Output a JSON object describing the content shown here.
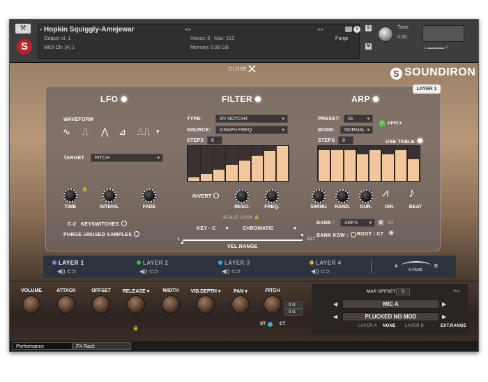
{
  "header": {
    "instrument": "Hopkin Squiggly-Amejewar",
    "output_label": "Output:",
    "output_val": "st. 1",
    "midi_label": "MIDI Ch:",
    "midi_val": "[A]  1",
    "voices_label": "Voices:",
    "voices_val": "0",
    "max_label": "Max:",
    "max_val": "512",
    "memory_label": "Memory:",
    "memory_val": "0.96 GB",
    "purge_label": "Purge",
    "solo": "S",
    "mute": "M",
    "tune_label": "Tune",
    "tune_val": "0.00",
    "aux_l": "L",
    "aux_r": "R"
  },
  "close_label": "CLOSE",
  "brand": "SOUNDIRON",
  "layer_chip": "LAYER 1",
  "lfo": {
    "title": "LFO",
    "waveform_label": "WAVEFORM",
    "waves": [
      "∿",
      "⎍",
      "⋀",
      "⊿",
      "⎍⎍"
    ],
    "target_label": "TARGET",
    "target_val": "PITCH",
    "knobs": [
      "TIME",
      "INTENS.",
      "FADE"
    ],
    "keyswitch_note": "C-2",
    "keyswitch_label": "KEYSWITCHES",
    "purge_label": "PURGE UNUSED SAMPLES"
  },
  "filter": {
    "title": "FILTER",
    "type_label": "TYPE:",
    "type_val": "SV NOTCH4",
    "source_label": "SOURCE:",
    "source_val": "GRAPH FREQ",
    "steps_label": "STEPS",
    "steps_val": "8",
    "steps_values": [
      0.1,
      0.2,
      0.32,
      0.45,
      0.58,
      0.72,
      0.86,
      1.0
    ],
    "invert_label": "INVERT",
    "knobs": [
      "RESO.",
      "FREQ."
    ],
    "scale_lock_label": "SCALE LOCK",
    "key_val": "KEY - C",
    "scale_val": "CHROMATIC",
    "vel_min": "1",
    "vel_max": "127",
    "vel_label": "VEL.RANGE"
  },
  "arp": {
    "title": "ARP",
    "preset_label": "PRESET:",
    "preset_val": "01",
    "apply_label": "APPLY",
    "mode_label": "MODE:",
    "mode_val": "NORMAL",
    "steps_label": "STEPS",
    "steps_val": "8",
    "use_table_label": "USE TABLE",
    "steps_values": [
      0.88,
      0.88,
      0.88,
      0.75,
      0.88,
      0.75,
      0.88,
      0.62
    ],
    "knobs": [
      "SWING",
      "RAND.",
      "DUR."
    ],
    "dir_label": "DIR.",
    "beat_label": "BEAT",
    "bank_label": "BANK :",
    "bank_val": "ARPS",
    "bank_ksw_label": "BANK KSW :",
    "root_label": "ROOT :",
    "root_val": "C7"
  },
  "layers": [
    {
      "label": "LAYER 1",
      "color": "#8b7cf6"
    },
    {
      "label": "LAYER 2",
      "color": "#4caf50"
    },
    {
      "label": "LAYER 3",
      "color": "#29b6d8"
    },
    {
      "label": "LAYER 4",
      "color": "#e8a23a"
    }
  ],
  "xfade": {
    "a": "A",
    "b": "B",
    "label": "X-FADE"
  },
  "bottom": {
    "knobs": [
      "VOLUME",
      "ATTACK",
      "OFFSET",
      "RELEASE ▾",
      "WIDTH",
      "VIB.DEPTH ▾",
      "PAN ▾",
      "PITCH"
    ],
    "pitch_st": "0 st",
    "pitch_ct": "0 ct",
    "st_label": "ST",
    "ct_label": "CT",
    "map_offset_label": "MAP OFFSET :",
    "map_offset_val": "0",
    "mic": "MIC A",
    "articulation": "PLUCKED NO MOD",
    "layer_a": "LAYER A",
    "none": "NONE",
    "layer_b": "LAYER B",
    "ext_range": "EXT.RANGE"
  },
  "tabs": [
    "Performance",
    "FX Rack"
  ]
}
